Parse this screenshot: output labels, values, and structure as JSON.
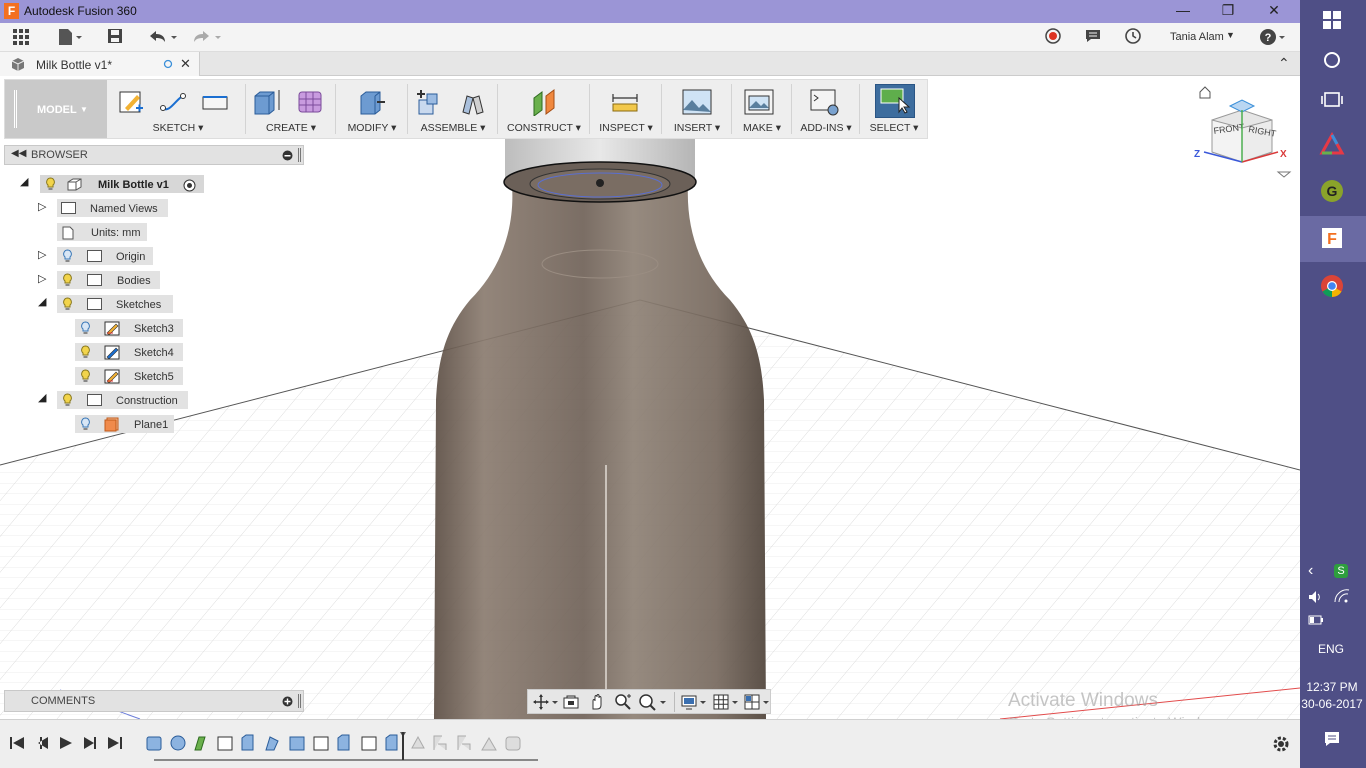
{
  "window": {
    "title": "Autodesk Fusion 360",
    "user": "Tania Alam",
    "minimize_icon": "minimize-icon",
    "restore_icon": "restore-icon",
    "close_icon": "close-icon"
  },
  "document_tab": {
    "label": "Milk Bottle v1*"
  },
  "toolbar": {
    "workspace": "MODEL",
    "groups": [
      {
        "label": "SKETCH"
      },
      {
        "label": "CREATE"
      },
      {
        "label": "MODIFY"
      },
      {
        "label": "ASSEMBLE"
      },
      {
        "label": "CONSTRUCT"
      },
      {
        "label": "INSPECT"
      },
      {
        "label": "INSERT"
      },
      {
        "label": "MAKE"
      },
      {
        "label": "ADD-INS"
      },
      {
        "label": "SELECT"
      }
    ]
  },
  "browser": {
    "header": "BROWSER",
    "root": "Milk Bottle v1",
    "items": [
      {
        "label": "Named Views"
      },
      {
        "label": "Units: mm"
      },
      {
        "label": "Origin"
      },
      {
        "label": "Bodies"
      },
      {
        "label": "Sketches"
      },
      {
        "label": "Sketch3"
      },
      {
        "label": "Sketch4"
      },
      {
        "label": "Sketch5"
      },
      {
        "label": "Construction"
      },
      {
        "label": "Plane1"
      }
    ]
  },
  "comments": {
    "header": "COMMENTS"
  },
  "viewcube": {
    "front": "FRONT",
    "right": "RIGHT",
    "axis_z": "Z",
    "axis_x": "X"
  },
  "watermark": {
    "line1": "Activate Windows",
    "line2": "Go to Settings to activate Windows."
  },
  "taskbar": {
    "language": "ENG",
    "time": "12:37 PM",
    "date": "30-06-2017"
  },
  "colors": {
    "titlebar": "#9b95d6",
    "taskbar": "#4f4f86",
    "bottle": "#7a6a5e",
    "select_active": "#3d6d9e"
  }
}
